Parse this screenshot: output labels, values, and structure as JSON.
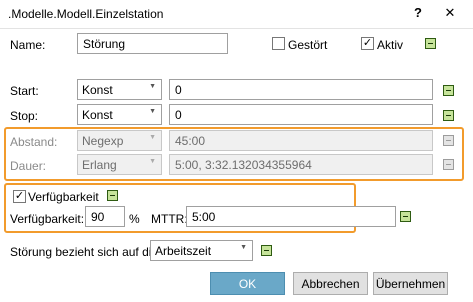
{
  "window": {
    "title": ".Modelle.Modell.Einzelstation",
    "help": "?",
    "close": "✕"
  },
  "name": {
    "label": "Name:",
    "value": "Störung"
  },
  "gestoert": {
    "label": "Gestört",
    "checked": false
  },
  "aktiv": {
    "label": "Aktiv",
    "checked": true,
    "check_mark": "✓"
  },
  "start": {
    "label": "Start:",
    "type": "Konst",
    "value": "0"
  },
  "stop": {
    "label": "Stop:",
    "type": "Konst",
    "value": "0"
  },
  "abstand": {
    "label": "Abstand:",
    "type": "Negexp",
    "value": "45:00"
  },
  "dauer": {
    "label": "Dauer:",
    "type": "Erlang",
    "value": "5:00, 3:32.132034355964"
  },
  "verfuegbarkeit_section": {
    "label": "Verfügbarkeit",
    "checked": true,
    "check_mark": "✓"
  },
  "verfuegbarkeit": {
    "label": "Verfügbarkeit:",
    "value": "90",
    "unit": "%"
  },
  "mttr": {
    "label": "MTTR:",
    "value": "5:00"
  },
  "bezug": {
    "label": "Störung bezieht sich auf die:",
    "value": "Arbeitszeit"
  },
  "buttons": {
    "ok": "OK",
    "abbrechen": "Abbrechen",
    "uebernehmen": "Übernehmen"
  },
  "colors": {
    "highlight": "#f29b2c",
    "ok_button": "#6aa8c8",
    "green_button": "#c6e49a"
  }
}
